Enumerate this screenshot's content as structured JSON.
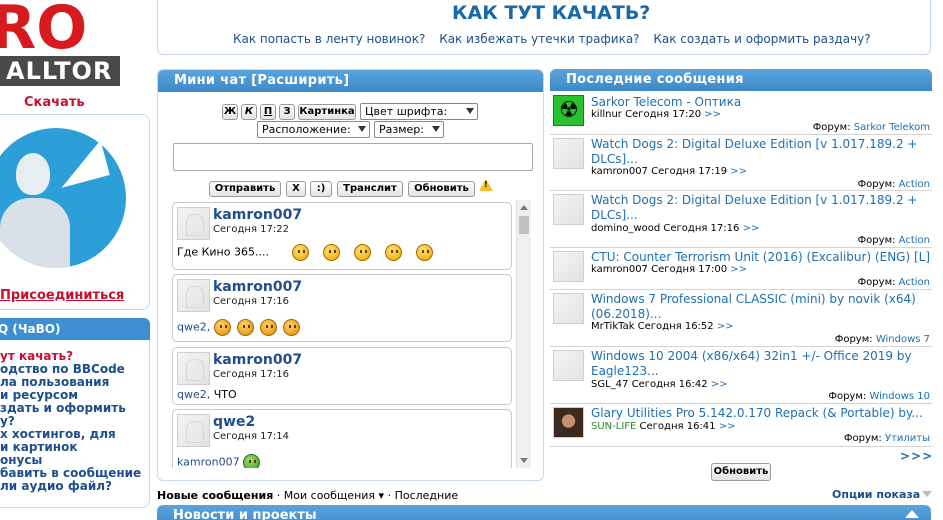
{
  "logo": {
    "letters": "RO",
    "bar_text": "ALLTOR",
    "download": "Скачать"
  },
  "left": {
    "join": "Присоединиться",
    "faq_title": "Q (ЧаВО)",
    "faq_items": [
      "ут качать?",
      "одство по BBCode",
      "ла пользования",
      "и ресурсом",
      "здать и оформить",
      "у?",
      "х хостингов, для",
      "и картинок",
      "онусы",
      "бавить в сообщение",
      "ли аудио файл?"
    ]
  },
  "howto": {
    "title": "КАК ТУТ КАЧАТЬ?",
    "links": [
      "Как попасть в ленту новинок?",
      "Как избежать утечки трафика?",
      "Как создать и оформить раздачу?"
    ]
  },
  "chat": {
    "title": "Мини чат",
    "expand": "Расширить",
    "format": {
      "bold": "Ж",
      "italic": "К",
      "underline": "П",
      "strike": "З",
      "image": "Картинка"
    },
    "font_color": "Цвет шрифта:",
    "position": "Расположение:",
    "size": "Размер:",
    "buttons": {
      "send": "Отправить",
      "clear": "X",
      "smiley": ":)",
      "translit": "Транслит",
      "refresh": "Обновить"
    },
    "messages": [
      {
        "name": "kamron007",
        "time": "Сегодня 17:22",
        "text": "Где Кино 365....",
        "smilies": 5
      },
      {
        "name": "kamron007",
        "time": "Сегодня 17:16",
        "mention": "qwe2,",
        "text": "",
        "smilies": 4
      },
      {
        "name": "kamron007",
        "time": "Сегодня 17:16",
        "mention": "qwe2,",
        "text": "ЧТО",
        "smilies": 0
      },
      {
        "name": "qwe2",
        "time": "Сегодня 17:14",
        "mention": "kamron007",
        "text": "",
        "smilies": 1
      }
    ]
  },
  "recent": {
    "title": "Последние сообщения",
    "forum_label": "Форум:",
    "posts": [
      {
        "title": [
          "Sarkor Telecom - Оптика"
        ],
        "user": "killnur",
        "time": "Сегодня 17:20",
        "forum": "Sarkor Telekom",
        "thumb": "nuke"
      },
      {
        "title": [
          "Watch Dogs 2: Digital Deluxe Edition [v 1.017.189.2 +",
          "DLCs]..."
        ],
        "user": "kamron007",
        "time": "Сегодня 17:19",
        "forum": "Action",
        "thumb": "blank"
      },
      {
        "title": [
          "Watch Dogs 2: Digital Deluxe Edition [v 1.017.189.2 +",
          "DLCs]..."
        ],
        "user": "domino_wood",
        "time": "Сегодня 17:16",
        "forum": "Action",
        "thumb": "blank"
      },
      {
        "title": [
          "CTU: Counter Terrorism Unit (2016) (Excalibur) (ENG) [L]"
        ],
        "user": "kamron007",
        "time": "Сегодня 17:00",
        "forum": "Action",
        "thumb": "blank"
      },
      {
        "title": [
          "Windows 7 Professional CLASSIC (mini) by novik (x64)",
          "(06.2018)..."
        ],
        "user": "MrTikTak",
        "time": "Сегодня 16:52",
        "forum": "Windows 7",
        "thumb": "blank"
      },
      {
        "title": [
          "Windows 10 2004 (x86/x64) 32in1 +/- Office 2019 by",
          "Eagle123..."
        ],
        "user": "SGL_47",
        "time": "Сегодня 16:42",
        "forum": "Windows 10",
        "thumb": "blank"
      },
      {
        "title": [
          "Glary Utilities Pro 5.142.0.170 Repack (& Portable) by..."
        ],
        "user": "SUN-LIFE",
        "time": "Сегодня 16:41",
        "forum": "Утилиты",
        "thumb": "photo"
      }
    ],
    "goto": ">>",
    "more": ">>>",
    "refresh": "Обновить"
  },
  "tabs": {
    "new": "Новые сообщения",
    "mine": "Мои сообщения",
    "latest": "Последние",
    "options": "Опции показа"
  },
  "news": {
    "title": "Новости и проекты"
  }
}
